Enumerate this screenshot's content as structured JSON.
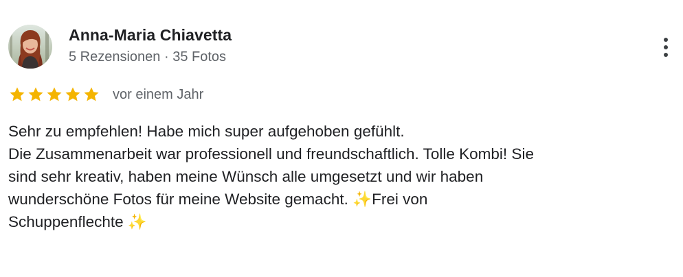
{
  "review": {
    "author_name": "Anna-Maria Chiavetta",
    "author_meta": "5 Rezensionen · 35 Fotos",
    "rating": 5,
    "rating_max": 5,
    "star_color": "#f4b400",
    "date": "vor einem Jahr",
    "text_lines": [
      "Sehr zu empfehlen! Habe mich super aufgehoben gefühlt.",
      "Die Zusammenarbeit war professionell und freundschaftlich. Tolle Kombi! Sie",
      "sind sehr kreativ, haben meine Wünsch alle umgesetzt und wir haben",
      "wunderschöne Fotos für meine Website gemacht. ✨Frei von",
      "Schuppenflechte ✨"
    ]
  },
  "icons": {
    "more": "more-vert-icon",
    "star": "star-icon",
    "avatar": "profile-photo"
  }
}
